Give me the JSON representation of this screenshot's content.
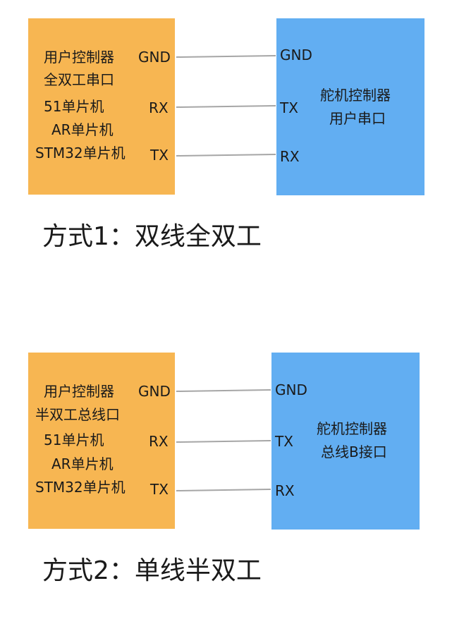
{
  "colors": {
    "user_box": "#f7b652",
    "servo_box": "#62aef2",
    "wire": "#a6a6a6",
    "text": "#1a1a1a"
  },
  "diagram1": {
    "user_lines": [
      "用户控制器",
      "全双工串口",
      "51单片机",
      "AR单片机",
      "STM32单片机"
    ],
    "user_pins": [
      "GND",
      "RX",
      "TX"
    ],
    "servo_pins": [
      "GND",
      "TX",
      "RX"
    ],
    "servo_lines": [
      "舵机控制器",
      "用户串口"
    ],
    "caption": "方式1：双线全双工"
  },
  "diagram2": {
    "user_lines": [
      "用户控制器",
      "半双工总线口",
      "51单片机",
      "AR单片机",
      "STM32单片机"
    ],
    "user_pins": [
      "GND",
      "RX",
      "TX"
    ],
    "servo_pins": [
      "GND",
      "TX",
      "RX"
    ],
    "servo_lines": [
      "舵机控制器",
      "总线B接口"
    ],
    "caption": "方式2：单线半双工"
  }
}
